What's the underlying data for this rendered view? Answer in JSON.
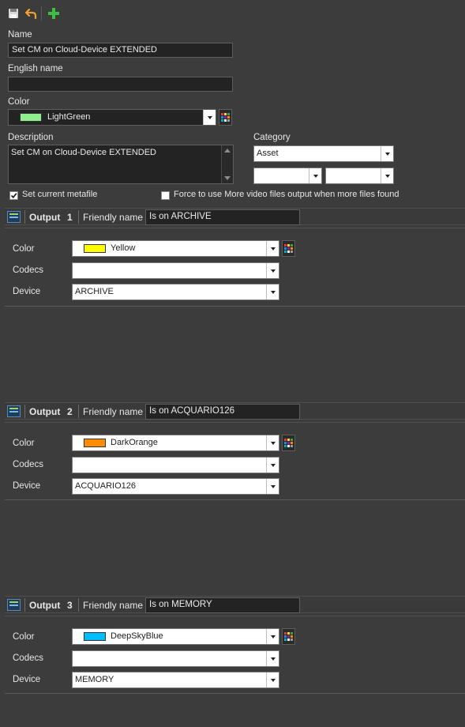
{
  "toolbar": {
    "save_icon": "save-icon",
    "undo_icon": "undo-icon",
    "add_icon": "add-icon"
  },
  "form": {
    "name_label": "Name",
    "name_value": "Set CM on Cloud-Device EXTENDED",
    "english_name_label": "English name",
    "english_name_value": "",
    "color_label": "Color",
    "color_value": "LightGreen",
    "color_hex": "#90ee90",
    "description_label": "Description",
    "description_value": "Set CM on Cloud-Device EXTENDED",
    "category_label": "Category",
    "category_value": "Asset",
    "category_sub1": "",
    "category_sub2": "",
    "set_current_metafile_label": "Set current metafile",
    "set_current_metafile_checked": true,
    "force_more_video_label": "Force to use More video files output  when more files found",
    "force_more_video_checked": false
  },
  "outputs": [
    {
      "title": "Output",
      "number": "1",
      "friendly_label": "Friendly name",
      "friendly_value": "Is on ARCHIVE",
      "color_label": "Color",
      "color_value": "Yellow",
      "color_hex": "#ffff00",
      "codecs_label": "Codecs",
      "codecs_value": "",
      "device_label": "Device",
      "device_value": "ARCHIVE"
    },
    {
      "title": "Output",
      "number": "2",
      "friendly_label": "Friendly name",
      "friendly_value": "Is on ACQUARIO126",
      "color_label": "Color",
      "color_value": "DarkOrange",
      "color_hex": "#ff8c00",
      "codecs_label": "Codecs",
      "codecs_value": "",
      "device_label": "Device",
      "device_value": "ACQUARIO126"
    },
    {
      "title": "Output",
      "number": "3",
      "friendly_label": "Friendly name",
      "friendly_value": "Is on MEMORY",
      "color_label": "Color",
      "color_value": "DeepSkyBlue",
      "color_hex": "#00bfff",
      "codecs_label": "Codecs",
      "codecs_value": "",
      "device_label": "Device",
      "device_value": "MEMORY"
    }
  ],
  "palette_colors": [
    "#e53935",
    "#fdd835",
    "#43a047",
    "#1e88e5",
    "#8e24aa",
    "#fb8c00",
    "#00acc1",
    "#ffffff",
    "#9e9e9e"
  ]
}
